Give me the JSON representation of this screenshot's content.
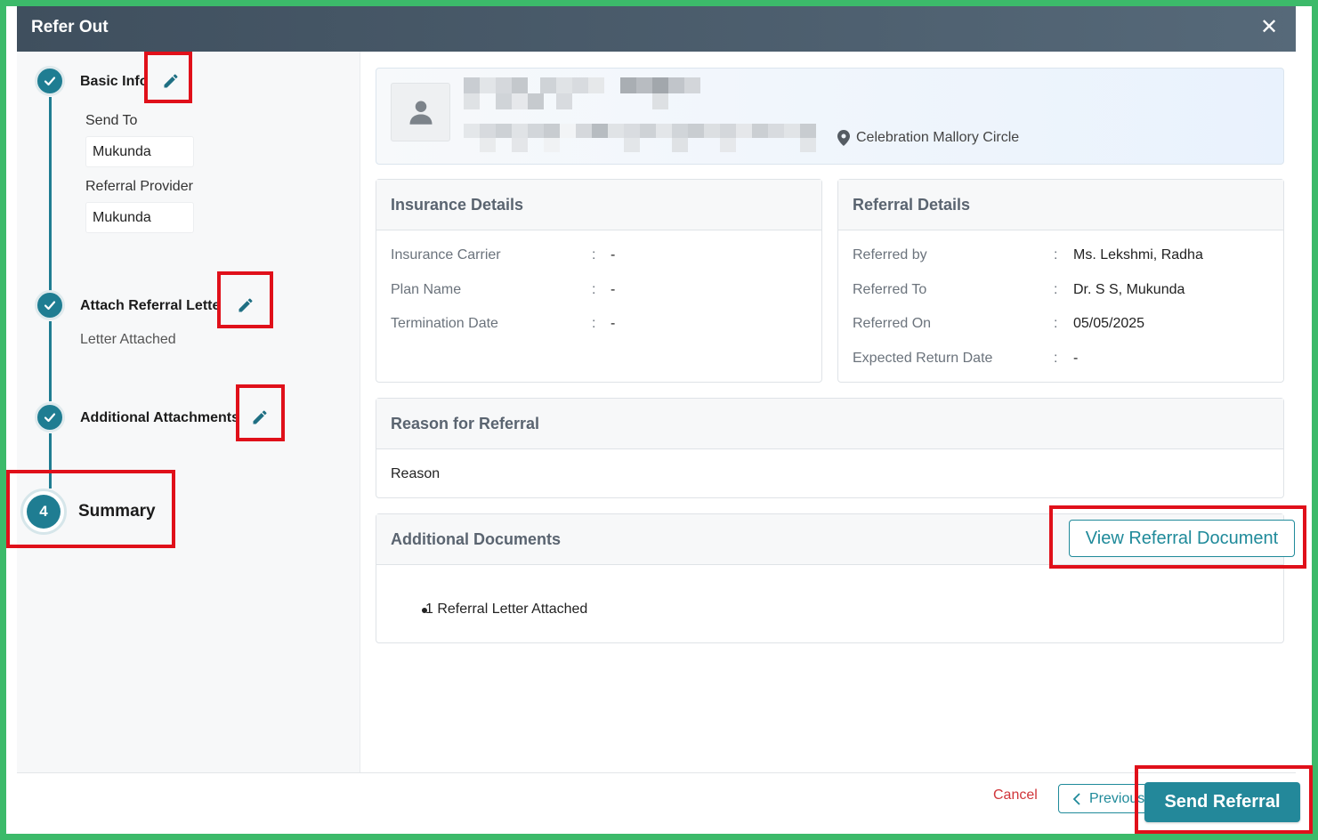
{
  "header": {
    "title": "Refer Out",
    "close_label": "✕"
  },
  "stepper": {
    "basic_info": {
      "title": "Basic Info",
      "send_to_label": "Send To",
      "send_to_value": "Mukunda",
      "referral_provider_label": "Referral Provider",
      "referral_provider_value": "Mukunda"
    },
    "attach_letter": {
      "title": "Attach Referral Letter",
      "status": "Letter Attached"
    },
    "additional_attachments": {
      "title": "Additional Attachments"
    },
    "summary": {
      "number": "4",
      "title": "Summary"
    }
  },
  "patient": {
    "location": "Celebration Mallory Circle"
  },
  "insurance": {
    "title": "Insurance Details",
    "rows": [
      {
        "label": "Insurance Carrier",
        "sep": ":",
        "value": "-"
      },
      {
        "label": "Plan Name",
        "sep": ":",
        "value": "-"
      },
      {
        "label": "Termination Date",
        "sep": ":",
        "value": "-"
      }
    ]
  },
  "referral": {
    "title": "Referral Details",
    "rows": [
      {
        "label": "Referred by",
        "sep": ":",
        "value": "Ms. Lekshmi, Radha"
      },
      {
        "label": "Referred To",
        "sep": ":",
        "value": "Dr. S S, Mukunda"
      },
      {
        "label": "Referred On",
        "sep": ":",
        "value": "05/05/2025"
      },
      {
        "label": "Expected Return Date",
        "sep": ":",
        "value": "-"
      }
    ]
  },
  "reason": {
    "title": "Reason for Referral",
    "text": "Reason"
  },
  "documents": {
    "title": "Additional Documents",
    "view_button": "View Referral Document",
    "items": [
      "1 Referral Letter Attached"
    ]
  },
  "footer": {
    "cancel": "Cancel",
    "previous": "Previous",
    "send": "Send Referral"
  },
  "colors": {
    "accent": "#1f7d92",
    "highlight": "#e0101a",
    "frame": "#3cba6a",
    "cancel": "#d0353a"
  },
  "icons": [
    "check-icon",
    "edit-pencil-icon",
    "close-icon",
    "user-icon",
    "map-pin-icon",
    "chevron-left-icon"
  ]
}
